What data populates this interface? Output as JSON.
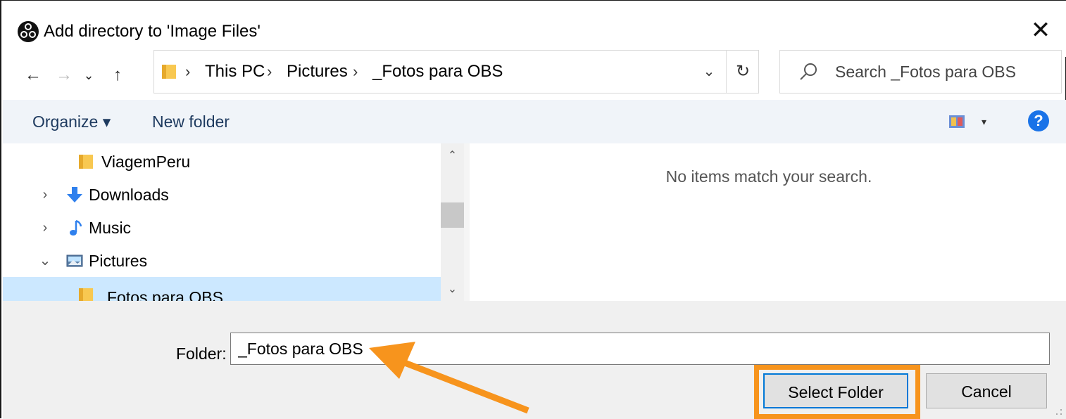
{
  "window": {
    "title": "Add directory to 'Image Files'",
    "close_glyph": "✕"
  },
  "nav": {
    "back_glyph": "←",
    "forward_glyph": "→",
    "recent_glyph": "⌄",
    "up_glyph": "↑"
  },
  "address": {
    "crumbs": [
      "This PC",
      "Pictures",
      "_Fotos para OBS"
    ],
    "separator": "›",
    "dropdown_glyph": "⌄",
    "refresh_glyph": "↻"
  },
  "search": {
    "placeholder": "Search _Fotos para OBS"
  },
  "toolbar": {
    "organize_label": "Organize ▾",
    "new_folder_label": "New folder",
    "view_caret": "▾",
    "help_glyph": "?"
  },
  "tree": {
    "items": [
      {
        "label": "ViagemPeru",
        "icon": "folder-icon",
        "chevron": ""
      },
      {
        "label": "Downloads",
        "icon": "download-arrow-icon",
        "chevron": "›"
      },
      {
        "label": "Music",
        "icon": "music-note-icon",
        "chevron": "›"
      },
      {
        "label": "Pictures",
        "icon": "pictures-icon",
        "chevron": "⌄"
      },
      {
        "label": "Fotos para OBS",
        "icon": "folder-icon",
        "chevron": "",
        "selected": true
      }
    ]
  },
  "content": {
    "empty_message": "No items match your search."
  },
  "footer": {
    "folder_label": "Folder:",
    "folder_value": "_Fotos para OBS",
    "select_button": "Select Folder",
    "cancel_button": "Cancel"
  },
  "colors": {
    "accent": "#0078d7",
    "highlight_orange": "#f7941d",
    "selection": "#cce8ff",
    "folder_yellow": "#f8c851"
  }
}
